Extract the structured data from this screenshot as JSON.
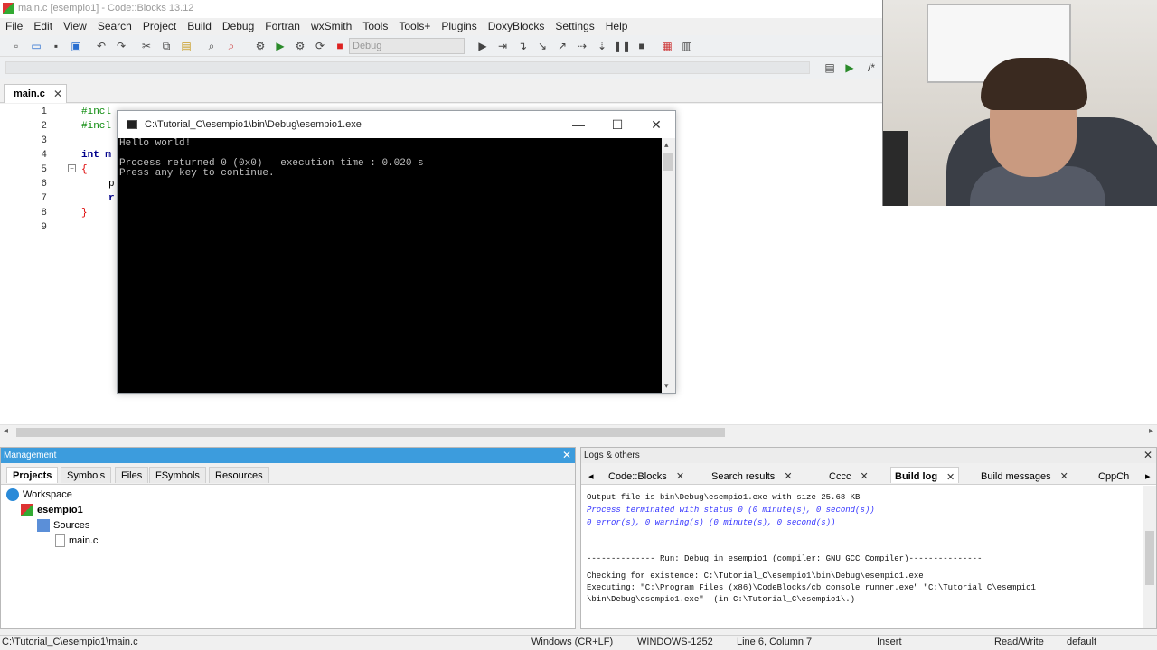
{
  "window": {
    "title": "main.c [esempio1] - Code::Blocks 13.12"
  },
  "menu": [
    "File",
    "Edit",
    "View",
    "Search",
    "Project",
    "Build",
    "Debug",
    "Fortran",
    "wxSmith",
    "Tools",
    "Tools+",
    "Plugins",
    "DoxyBlocks",
    "Settings",
    "Help"
  ],
  "toolbar": {
    "build_target": "Debug"
  },
  "editor": {
    "tab_label": "main.c",
    "tab_close": "✕",
    "line_numbers": [
      "1",
      "2",
      "3",
      "4",
      "5",
      "6",
      "7",
      "8",
      "9"
    ],
    "visible_code": {
      "l1": "#incl",
      "l2": "#incl",
      "l4": "int m",
      "l5": "{",
      "l6": "p",
      "l7": "r",
      "l8": "}"
    }
  },
  "console": {
    "title": "C:\\Tutorial_C\\esempio1\\bin\\Debug\\esempio1.exe",
    "lines": [
      "Hello world!",
      "",
      "Process returned 0 (0x0)   execution time : 0.020 s",
      "Press any key to continue."
    ],
    "min": "—",
    "max": "☐",
    "close": "✕"
  },
  "management": {
    "title": "Management",
    "tabs": [
      "Projects",
      "Symbols",
      "Files",
      "FSymbols",
      "Resources"
    ],
    "tree": {
      "workspace": "Workspace",
      "project": "esempio1",
      "folder": "Sources",
      "file": "main.c"
    }
  },
  "logs": {
    "title": "Logs & others",
    "tabs": [
      "Code::Blocks",
      "Search results",
      "Cccc",
      "Build log",
      "Build messages",
      "CppCh"
    ],
    "lines": [
      {
        "text": "Output file is bin\\Debug\\esempio1.exe with size 25.68 KB",
        "style": "normal"
      },
      {
        "text": "Process terminated with status 0 (0 minute(s), 0 second(s))",
        "style": "blue"
      },
      {
        "text": "0 error(s), 0 warning(s) (0 minute(s), 0 second(s))",
        "style": "blue"
      },
      {
        "text": "",
        "style": "normal"
      },
      {
        "text": "",
        "style": "normal"
      },
      {
        "text": "-------------- Run: Debug in esempio1 (compiler: GNU GCC Compiler)---------------",
        "style": "normal"
      },
      {
        "text": "",
        "style": "normal"
      },
      {
        "text": "Checking for existence: C:\\Tutorial_C\\esempio1\\bin\\Debug\\esempio1.exe",
        "style": "normal"
      },
      {
        "text": "Executing: \"C:\\Program Files (x86)\\CodeBlocks/cb_console_runner.exe\" \"C:\\Tutorial_C\\esempio1",
        "style": "normal"
      },
      {
        "text": "\\bin\\Debug\\esempio1.exe\"  (in C:\\Tutorial_C\\esempio1\\.)",
        "style": "normal"
      }
    ]
  },
  "status": {
    "path": "C:\\Tutorial_C\\esempio1\\main.c",
    "eol": "Windows (CR+LF)",
    "encoding": "WINDOWS-1252",
    "position": "Line 6, Column 7",
    "mode": "Insert",
    "access": "Read/Write",
    "lang": "default"
  }
}
